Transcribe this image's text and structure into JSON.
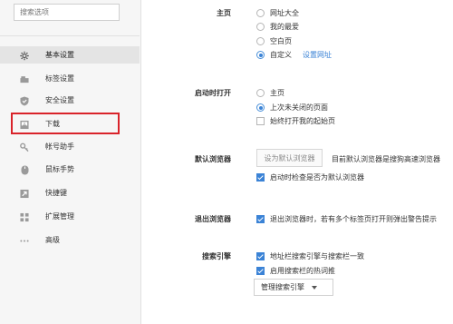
{
  "sidebar": {
    "search_placeholder": "搜索选项",
    "items": [
      {
        "label": "基本设置",
        "icon": "gear-icon"
      },
      {
        "label": "标签设置",
        "icon": "tab-icon"
      },
      {
        "label": "安全设置",
        "icon": "shield-icon"
      },
      {
        "label": "下载",
        "icon": "download-icon"
      },
      {
        "label": "帐号助手",
        "icon": "key-icon"
      },
      {
        "label": "鼠标手势",
        "icon": "mouse-icon"
      },
      {
        "label": "快捷键",
        "icon": "shortcut-icon"
      },
      {
        "label": "扩展管理",
        "icon": "extensions-icon"
      },
      {
        "label": "高级",
        "icon": "more-icon"
      }
    ],
    "active_item": "基本设置",
    "highlighted_item": "下载"
  },
  "homepage": {
    "label": "主页",
    "options": [
      "网址大全",
      "我的最爱",
      "空白页",
      "自定义"
    ],
    "selected": "自定义",
    "set_url_link": "设置网址"
  },
  "startup": {
    "label": "启动时打开",
    "options": [
      "主页",
      "上次未关闭的页面"
    ],
    "selected": "上次未关闭的页面",
    "checkbox_label": "始终打开我的起始页",
    "checkbox_checked": false
  },
  "default_browser": {
    "label": "默认浏览器",
    "button_label": "设为默认浏览器",
    "status_text": "目前默认浏览器是搜狗高速浏览器",
    "check_label": "启动时检查是否为默认浏览器",
    "check_checked": true
  },
  "exit_browser": {
    "label": "退出浏览器",
    "check_label": "退出浏览器时，若有多个标签页打开则弹出警告提示",
    "check_checked": true
  },
  "search_engine": {
    "label": "搜索引擎",
    "check1_label": "地址栏搜索引擎与搜索栏一致",
    "check1_checked": true,
    "check2_label": "启用搜索栏的热词推",
    "check2_checked": true,
    "manage_dropdown_label": "管理搜索引擎"
  },
  "colors": {
    "accent": "#3b83d6",
    "highlight_border": "#d9232a",
    "sidebar_bg": "#f6f6f6",
    "active_bg": "#e4e4e4"
  }
}
